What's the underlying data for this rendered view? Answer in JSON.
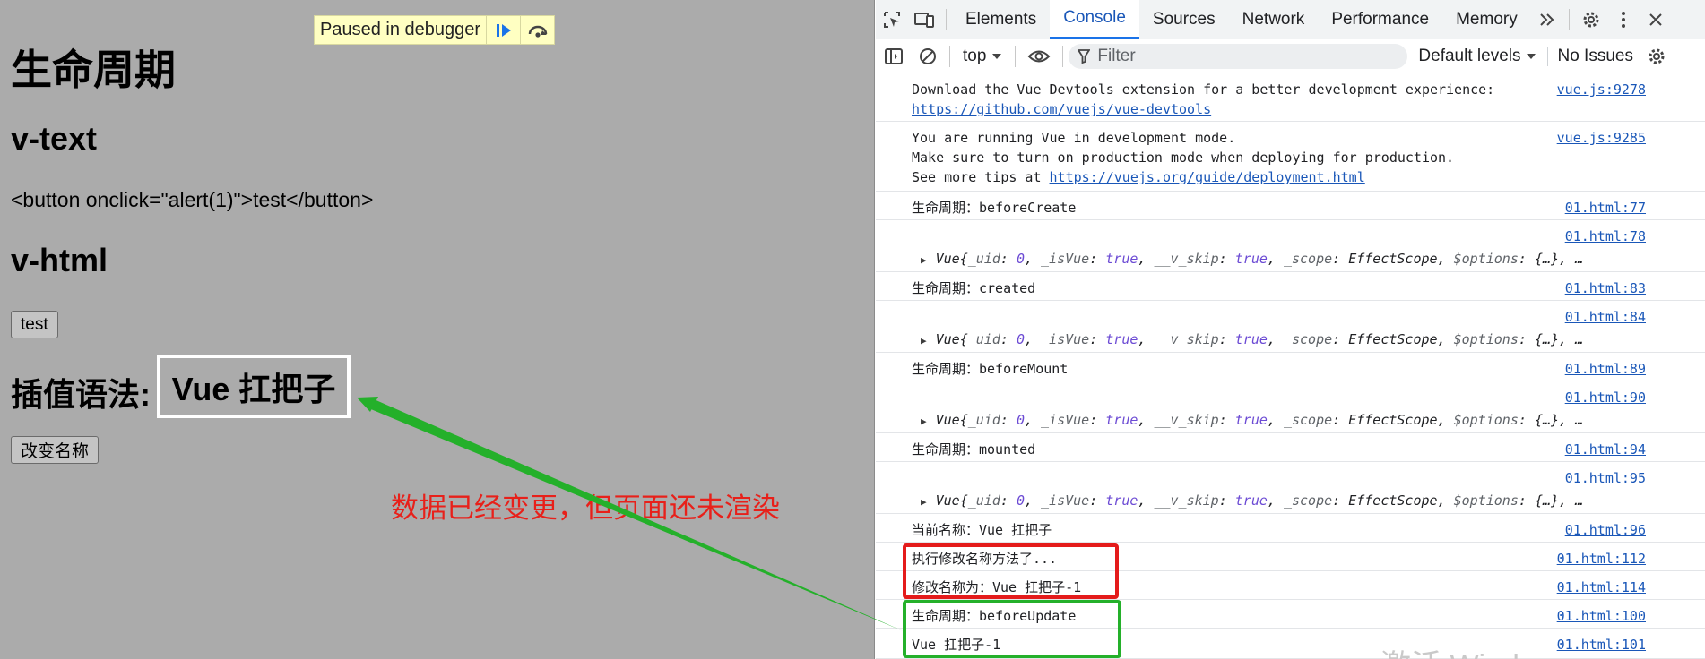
{
  "page": {
    "debugger_badge": "Paused in debugger",
    "title": "生命周期",
    "section_vtext": "v-text",
    "vtext_content": "<button onclick=\"alert(1)\">test</button>",
    "section_vhtml": "v-html",
    "test_button": "test",
    "interp_label": "插值语法:",
    "interp_value": "Vue 扛把子",
    "rename_button": "改变名称",
    "annotation": "数据已经变更，但页面还未渲染"
  },
  "devtools": {
    "tabs": [
      "Elements",
      "Console",
      "Sources",
      "Network",
      "Performance",
      "Memory"
    ],
    "active_tab": "Console",
    "context": "top",
    "filter_placeholder": "Filter",
    "levels": "Default levels",
    "issues": "No Issues",
    "console": [
      {
        "lines": [
          "Download the Vue Devtools extension for a better development experience:"
        ],
        "link": "https://github.com/vuejs/vue-devtools",
        "src": "vue.js:9278"
      },
      {
        "lines": [
          "You are running Vue in development mode.",
          "Make sure to turn on production mode when deploying for production.",
          "See more tips at "
        ],
        "link": "https://vuejs.org/guide/deployment.html",
        "src": "vue.js:9285"
      },
      {
        "text": "生命周期：beforeCreate",
        "src": "01.html:77"
      },
      {
        "obj": true,
        "src": "01.html:78"
      },
      {
        "text": "生命周期：created",
        "src": "01.html:83"
      },
      {
        "obj": true,
        "src": "01.html:84"
      },
      {
        "text": "生命周期：beforeMount",
        "src": "01.html:89"
      },
      {
        "obj": true,
        "src": "01.html:90"
      },
      {
        "text": "生命周期：mounted",
        "src": "01.html:94"
      },
      {
        "obj": true,
        "src": "01.html:95"
      },
      {
        "text": "当前名称：Vue 扛把子",
        "src": "01.html:96"
      },
      {
        "text": "执行修改名称方法了...",
        "src": "01.html:112"
      },
      {
        "text": "修改名称为：Vue 扛把子-1",
        "src": "01.html:114"
      },
      {
        "text": "生命周期：beforeUpdate",
        "src": "01.html:100"
      },
      {
        "text": "Vue 扛把子-1",
        "src": "01.html:101"
      }
    ],
    "vue_object": {
      "name": "Vue",
      "uid_key": "_uid",
      "uid_val": "0",
      "isvue_key": "_isVue",
      "isvue_val": "true",
      "skip_key": "__v_skip",
      "skip_val": "true",
      "scope_key": "_scope",
      "scope_val": "EffectScope",
      "options_key": "$options",
      "options_val": "{…}",
      "more": "…"
    }
  },
  "watermark": "激活 Windows",
  "colors": {
    "annotation": "#e8201a",
    "red_box": "#e41b1b",
    "green_box": "#24b02a",
    "link": "#1a57b8"
  }
}
